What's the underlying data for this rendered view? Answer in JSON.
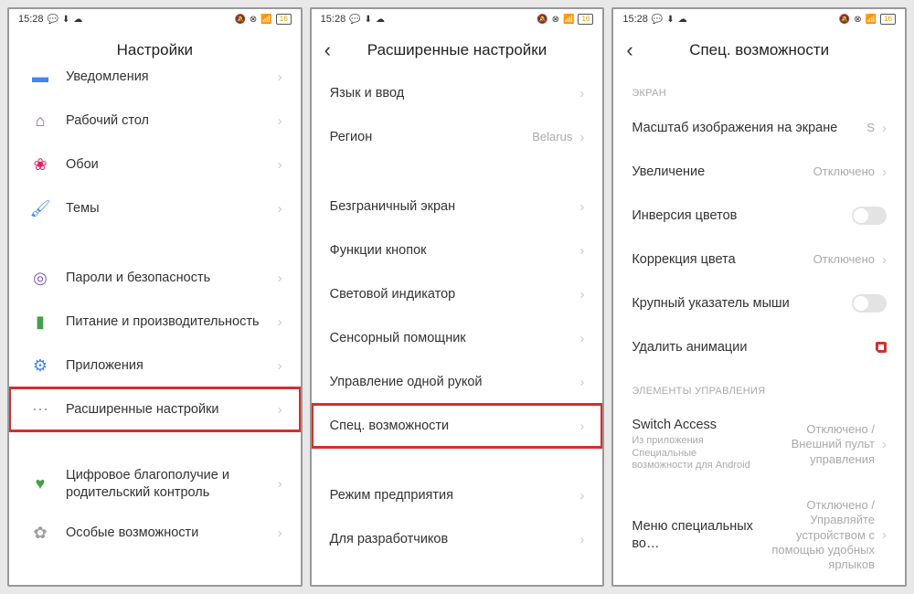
{
  "statusbar": {
    "time": "15:28",
    "battery": "16"
  },
  "screen1": {
    "title": "Настройки",
    "items": [
      {
        "icon": "🔔",
        "cls": "i-blue",
        "label": "Уведомления"
      },
      {
        "icon": "🏠",
        "cls": "i-purple",
        "label": "Рабочий стол"
      },
      {
        "icon": "🌷",
        "cls": "i-pink",
        "label": "Обои"
      },
      {
        "icon": "🖌",
        "cls": "i-blue",
        "label": "Темы"
      },
      {
        "icon": "◎",
        "cls": "i-purple",
        "label": "Пароли и безопасность"
      },
      {
        "icon": "▮",
        "cls": "i-green",
        "label": "Питание и производительность"
      },
      {
        "icon": "⚙",
        "cls": "i-blue",
        "label": "Приложения"
      },
      {
        "icon": "⋯",
        "cls": "i-gray",
        "label": "Расширенные настройки",
        "hl": true
      },
      {
        "icon": "♥",
        "cls": "i-green",
        "label": "Цифровое благополучие и родительский контроль"
      },
      {
        "icon": "✿",
        "cls": "i-gray",
        "label": "Особые возможности"
      }
    ]
  },
  "screen2": {
    "title": "Расширенные настройки",
    "items": [
      {
        "label": "Язык и ввод"
      },
      {
        "label": "Регион",
        "value": "Belarus"
      },
      {
        "label": "Безграничный экран"
      },
      {
        "label": "Функции кнопок"
      },
      {
        "label": "Световой индикатор"
      },
      {
        "label": "Сенсорный помощник"
      },
      {
        "label": "Управление одной рукой"
      },
      {
        "label": "Спец. возможности",
        "hl": true
      },
      {
        "label": "Режим предприятия"
      },
      {
        "label": "Для разработчиков"
      }
    ]
  },
  "screen3": {
    "title": "Спец. возможности",
    "section1": "ЭКРАН",
    "items1": [
      {
        "label": "Масштаб изображения на экране",
        "value": "S"
      },
      {
        "label": "Увеличение",
        "value": "Отключено"
      },
      {
        "label": "Инверсия цветов",
        "toggle": false
      },
      {
        "label": "Коррекция цвета",
        "value": "Отключено"
      },
      {
        "label": "Крупный указатель мыши",
        "toggle": false
      },
      {
        "label": "Удалить анимации",
        "toggle": true,
        "hlToggle": true
      }
    ],
    "section2": "ЭЛЕМЕНТЫ УПРАВЛЕНИЯ",
    "items2": [
      {
        "label": "Switch Access",
        "sub": "Из приложения Специальные возможности для Android",
        "value": "Отключено / Внешний пульт управления"
      },
      {
        "label": "Меню специальных во…",
        "value": "Отключено / Управляйте устройством с помощью удобных ярлыков"
      }
    ]
  }
}
